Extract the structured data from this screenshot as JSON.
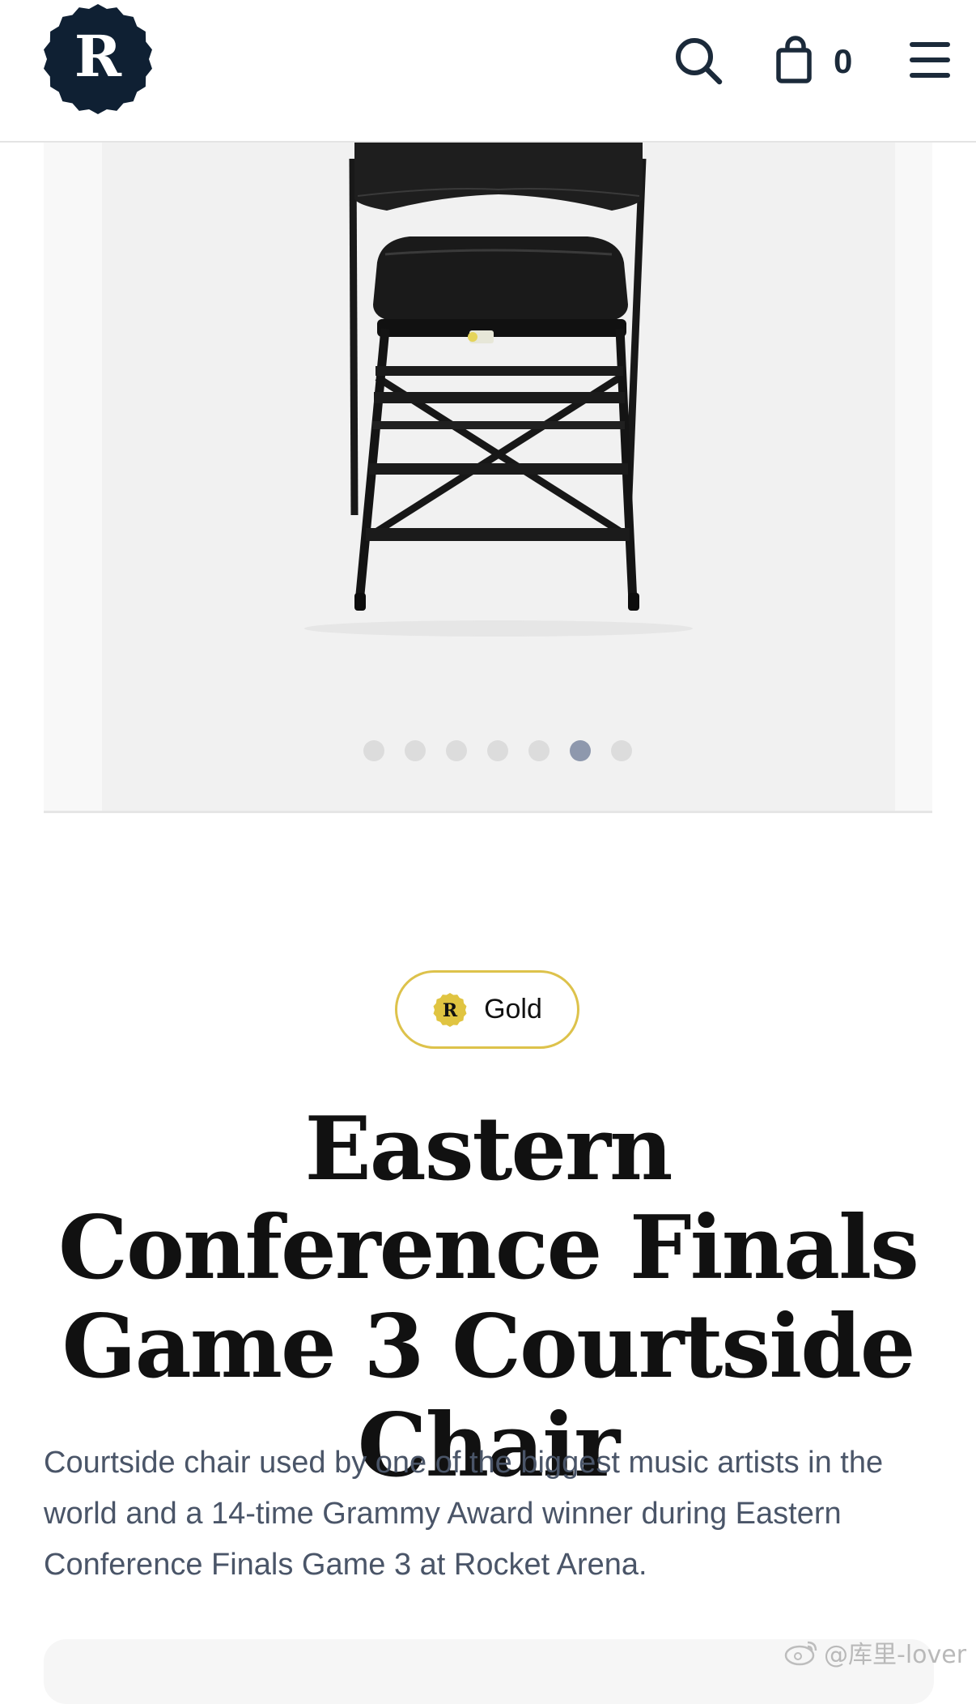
{
  "header": {
    "logo_letter": "R",
    "cart_count": "0"
  },
  "icons": {
    "logo": "r-seal-logo-icon",
    "search": "search-icon",
    "cart": "shopping-bag-icon",
    "menu": "hamburger-menu-icon"
  },
  "colors": {
    "brand_navy": "#0f2033",
    "tier_gold": "#ddc24b",
    "dot_active": "#8e98ad",
    "dot_inactive": "#dcdcdc",
    "description_text": "#4a5568"
  },
  "gallery": {
    "image": "black folding courtside chair",
    "slide_count": 7,
    "active_slide": 6
  },
  "product": {
    "tier_icon_letter": "R",
    "tier_label": "Gold",
    "title": "Eastern Conference Finals Game 3 Courtside Chair",
    "description": "Courtside chair used by one of the biggest music artists in the world and a 14-time Grammy Award winner during Eastern Conference Finals Game 3 at Rocket Arena."
  },
  "watermark": {
    "text": "@库里-lover"
  }
}
